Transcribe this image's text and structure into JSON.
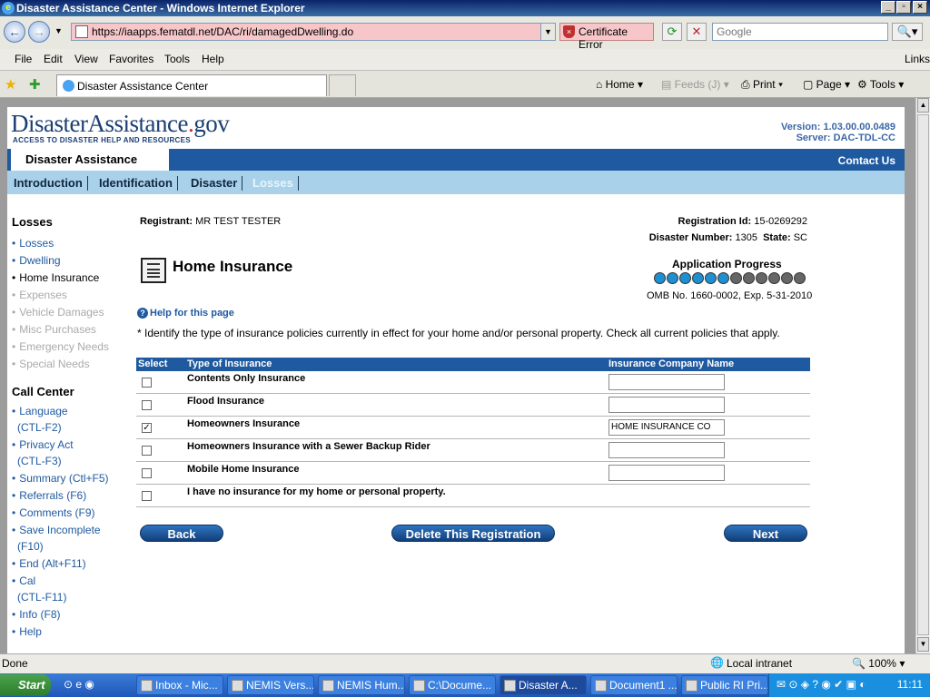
{
  "window": {
    "title": "Disaster Assistance Center - Windows Internet Explorer"
  },
  "browser": {
    "url": "https://iaapps.fematdl.net/DAC/ri/damagedDwelling.do",
    "cert_error": "Certificate Error",
    "search_placeholder": "Google",
    "menu": [
      "File",
      "Edit",
      "View",
      "Favorites",
      "Tools",
      "Help"
    ],
    "links": "Links",
    "tab_title": "Disaster Assistance Center",
    "toolbar": {
      "home": "Home",
      "feeds": "Feeds (J)",
      "print": "Print",
      "page": "Page",
      "tools": "Tools"
    }
  },
  "site": {
    "logo_main": "DisasterAssistance",
    "logo_dot": ".",
    "logo_gov": "gov",
    "logo_tagline": "ACCESS TO DISASTER HELP AND RESOURCES",
    "version": "Version: 1.03.00.00.0489",
    "server": "Server: DAC-TDL-CC",
    "banner_title": "Disaster Assistance",
    "contact": "Contact Us",
    "nav_tabs": [
      "Introduction",
      "Identification",
      "Disaster",
      "Losses"
    ]
  },
  "sidebar": {
    "losses_heading": "Losses",
    "losses_items": [
      "Losses",
      "Dwelling",
      "Home Insurance",
      "Expenses",
      "Vehicle Damages",
      "Misc Purchases",
      "Emergency Needs",
      "Special Needs"
    ],
    "callcenter_heading": "Call Center",
    "callcenter_items": [
      {
        "l1": "Language",
        "l2": "(CTL-F2)"
      },
      {
        "l1": "Privacy Act",
        "l2": "(CTL-F3)"
      },
      {
        "l1": "Summary (Ctl+F5)",
        "l2": ""
      },
      {
        "l1": "Referrals (F6)",
        "l2": ""
      },
      {
        "l1": "Comments (F9)",
        "l2": ""
      },
      {
        "l1": "Save Incomplete",
        "l2": "(F10)"
      },
      {
        "l1": "End (Alt+F11)",
        "l2": ""
      },
      {
        "l1": "Cal",
        "l2": "(CTL-F11)"
      },
      {
        "l1": "Info (F8)",
        "l2": ""
      },
      {
        "l1": "Help",
        "l2": ""
      }
    ]
  },
  "main": {
    "registrant_label": "Registrant:",
    "registrant_value": "MR TEST TESTER",
    "reg_id_label": "Registration Id:",
    "reg_id_value": "15-0269292",
    "disaster_label": "Disaster Number:",
    "disaster_value": "1305",
    "state_label": "State:",
    "state_value": "SC",
    "page_title": "Home Insurance",
    "progress_label": "Application Progress",
    "progress_done": 6,
    "progress_total": 12,
    "omb": "OMB No. 1660-0002, Exp. 5-31-2010",
    "help_link": "Help for this page",
    "instructions": "* Identify the type of insurance policies currently in effect for your home and/or personal property. Check all current policies that apply.",
    "table_headers": {
      "select": "Select",
      "type": "Type of Insurance",
      "company": "Insurance Company Name"
    },
    "rows": [
      {
        "type": "Contents Only Insurance",
        "checked": false,
        "company": "",
        "has_input": true
      },
      {
        "type": "Flood Insurance",
        "checked": false,
        "company": "",
        "has_input": true
      },
      {
        "type": "Homeowners Insurance",
        "checked": true,
        "company": "HOME INSURANCE CO",
        "has_input": true
      },
      {
        "type": "Homeowners Insurance with a Sewer Backup Rider",
        "checked": false,
        "company": "",
        "has_input": true
      },
      {
        "type": "Mobile Home Insurance",
        "checked": false,
        "company": "",
        "has_input": true
      },
      {
        "type": "I have no insurance for my home or personal property.",
        "checked": false,
        "company": "",
        "has_input": false
      }
    ],
    "buttons": {
      "back": "Back",
      "delete": "Delete This Registration",
      "next": "Next"
    }
  },
  "statusbar": {
    "status": "Done",
    "zone": "Local intranet",
    "zoom": "100%"
  },
  "taskbar": {
    "start": "Start",
    "tasks": [
      "Inbox - Mic...",
      "NEMIS Vers...",
      "NEMIS Hum...",
      "C:\\Docume...",
      "Disaster A...",
      "Document1 ...",
      "Public RI Pri..."
    ],
    "clock": "11:11"
  },
  "colors": {
    "brand_blue": "#1f5aa0",
    "nav_light": "#a9d1ea",
    "progress_done": "#1e8fd0",
    "progress_todo": "#666666"
  }
}
